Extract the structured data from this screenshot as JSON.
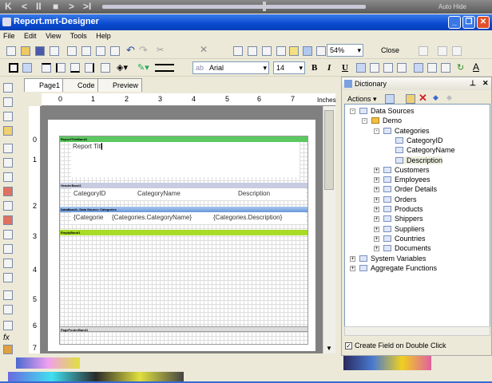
{
  "player": {
    "auto_hide": "Auto Hide",
    "buttons": [
      "K",
      "<",
      "II",
      "■",
      ">",
      ">I"
    ]
  },
  "window": {
    "title": "Report.mrt-Designer"
  },
  "menu": [
    "File",
    "Edit",
    "View",
    "Tools",
    "Help"
  ],
  "toolbar": {
    "zoom": "54%",
    "close": "Close",
    "font_prefix": "ab",
    "font": "Arial",
    "size": "14",
    "bold": "B",
    "italic": "I",
    "underline": "U",
    "color": "A"
  },
  "tabs": [
    "Page1",
    "Code",
    "Preview"
  ],
  "ruler": {
    "unit": "Inches",
    "h_ticks": [
      "0",
      "1",
      "2",
      "3",
      "4",
      "5",
      "6",
      "7"
    ],
    "v_ticks": [
      "0",
      "1",
      "2",
      "3",
      "4",
      "5",
      "6",
      "7"
    ]
  },
  "bands": {
    "report_title": {
      "header": "ReportTitleBand1",
      "text": "Report Titl"
    },
    "header": {
      "header": "HeaderBand1",
      "cols": [
        "CategoryID",
        "CategoryName",
        "Description"
      ]
    },
    "data": {
      "header": "DataBand1; Data Source: Categories",
      "cols": [
        "{Categorie",
        "{Categories.CategoryName}",
        "{Categories.Description}"
      ]
    },
    "empty": {
      "header": "EmptyBand1"
    },
    "footer": {
      "header": "PageFooterBand1"
    }
  },
  "dictionary": {
    "title": "Dictionary",
    "actions": "Actions",
    "tree": [
      {
        "label": "Data Sources",
        "level": 0,
        "exp": "-"
      },
      {
        "label": "Demo",
        "level": 1,
        "exp": "-"
      },
      {
        "label": "Categories",
        "level": 2,
        "exp": "-"
      },
      {
        "label": "CategoryID",
        "level": 3,
        "exp": ""
      },
      {
        "label": "CategoryName",
        "level": 3,
        "exp": ""
      },
      {
        "label": "Description",
        "level": 3,
        "exp": ""
      },
      {
        "label": "Customers",
        "level": 2,
        "exp": "+"
      },
      {
        "label": "Employees",
        "level": 2,
        "exp": "+"
      },
      {
        "label": "Order Details",
        "level": 2,
        "exp": "+"
      },
      {
        "label": "Orders",
        "level": 2,
        "exp": "+"
      },
      {
        "label": "Products",
        "level": 2,
        "exp": "+"
      },
      {
        "label": "Shippers",
        "level": 2,
        "exp": "+"
      },
      {
        "label": "Suppliers",
        "level": 2,
        "exp": "+"
      },
      {
        "label": "Countries",
        "level": 2,
        "exp": "+"
      },
      {
        "label": "Documents",
        "level": 2,
        "exp": "+"
      },
      {
        "label": "System Variables",
        "level": 0,
        "exp": "+"
      },
      {
        "label": "Aggregate Functions",
        "level": 0,
        "exp": "+"
      }
    ],
    "checkbox": "Create Field on Double Click",
    "checked": true
  }
}
